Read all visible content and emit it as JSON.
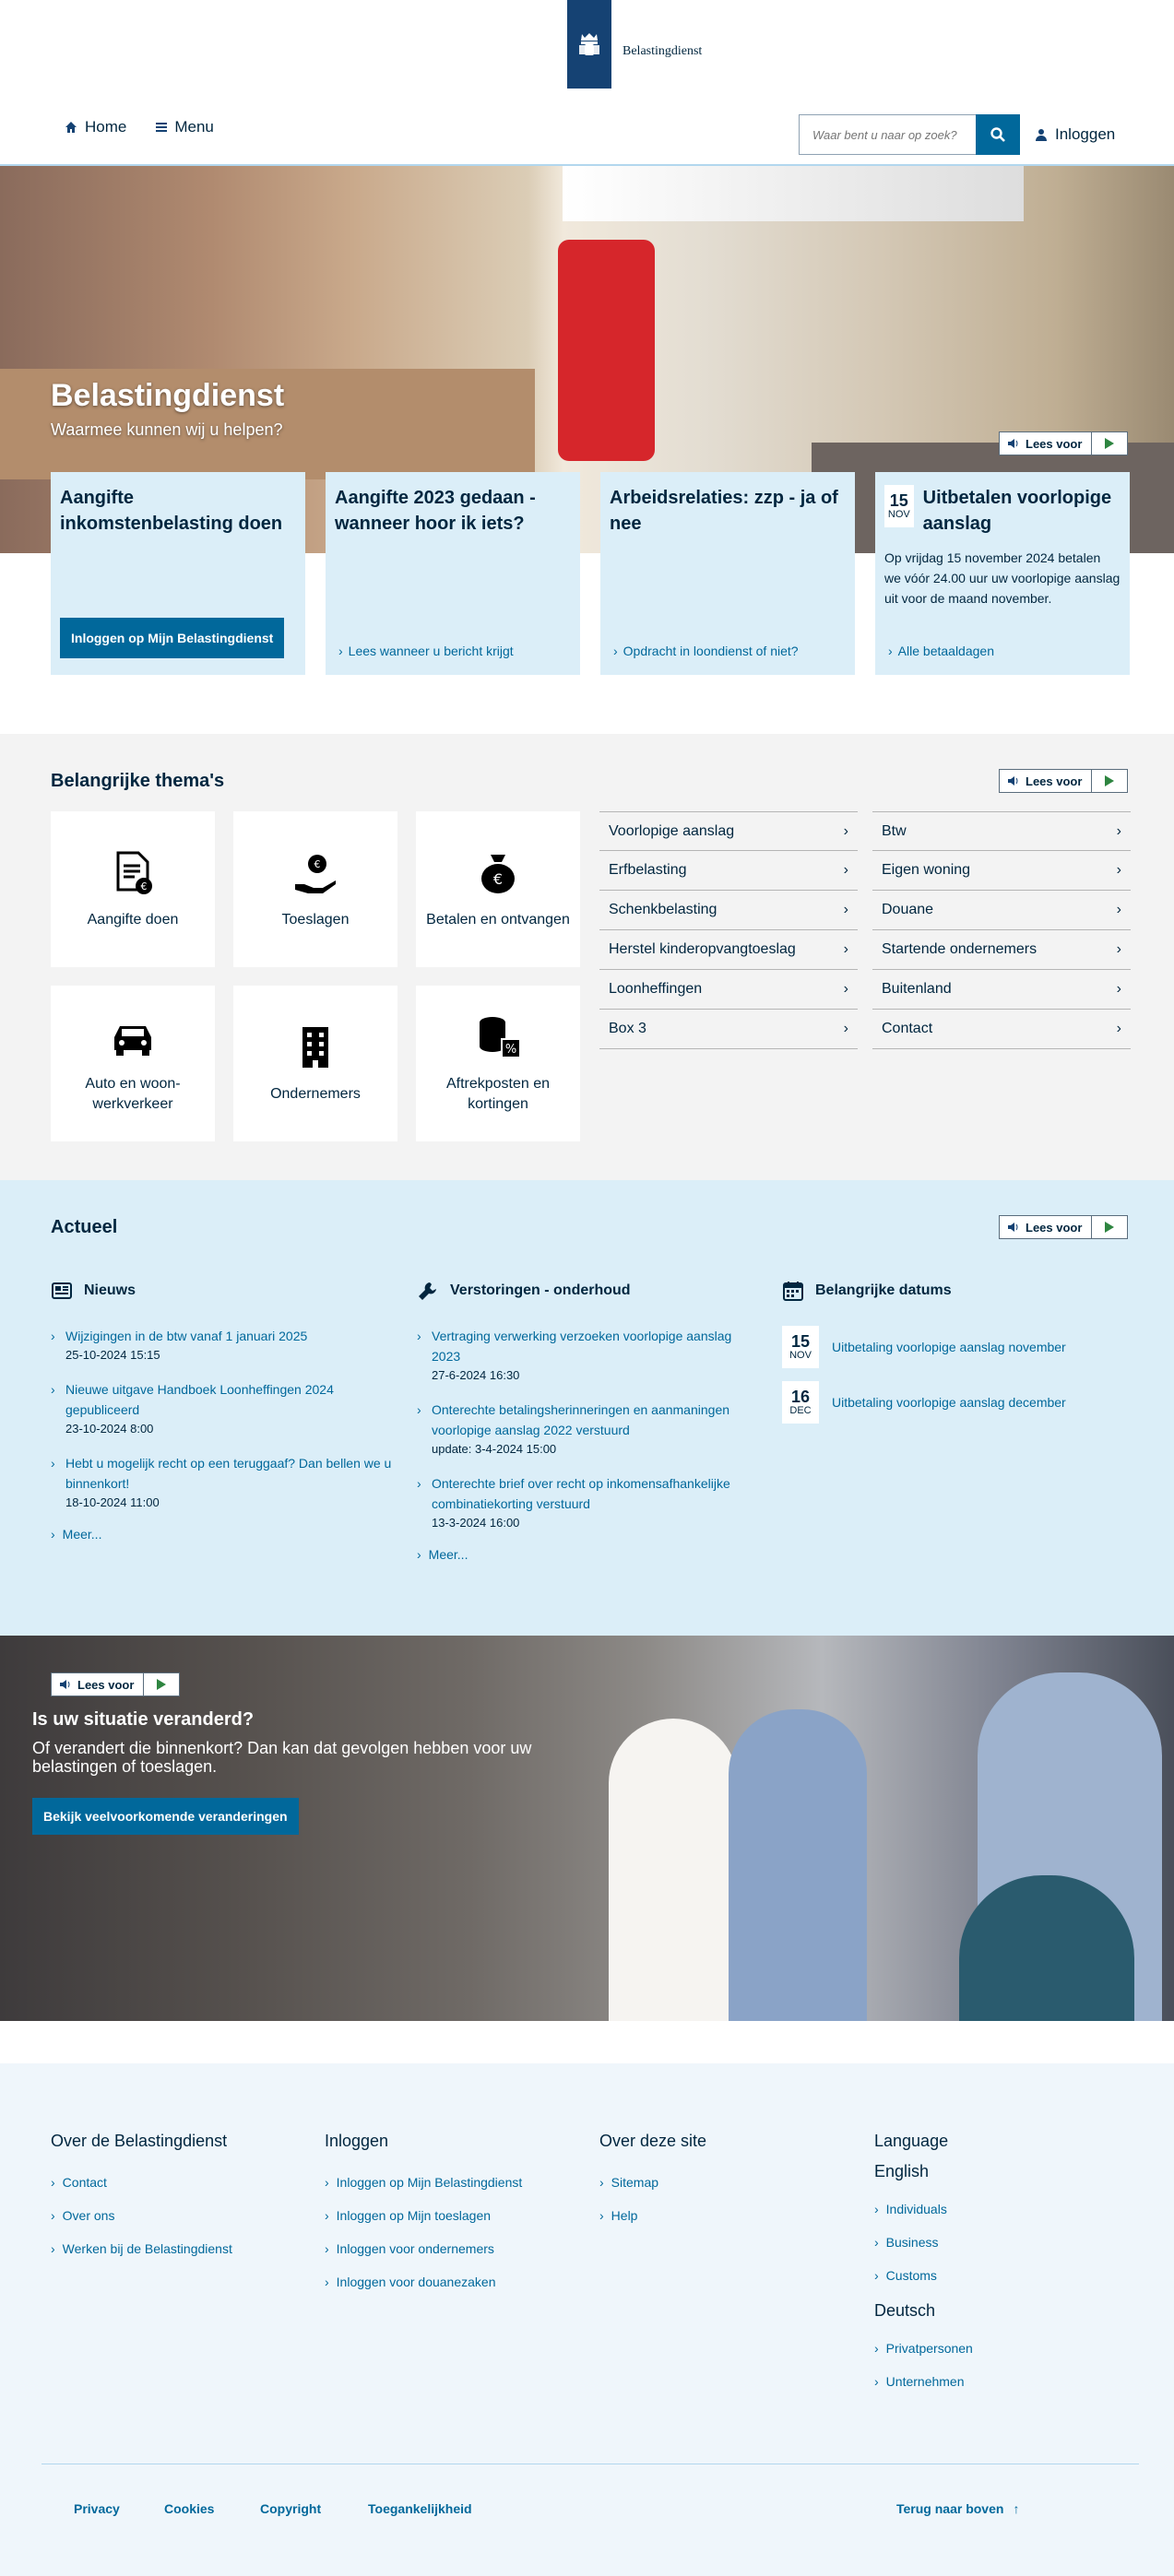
{
  "header": {
    "logo_text": "Belastingdienst",
    "nav_home": "Home",
    "nav_menu": "Menu",
    "search_placeholder": "Waar bent u naar op zoek?",
    "login": "Inloggen"
  },
  "hero": {
    "title": "Belastingdienst",
    "subtitle": "Waarmee kunnen wij u helpen?",
    "read_label": "Lees voor"
  },
  "cards": [
    {
      "title": "Aangifte inkomstenbelasting doen",
      "button": "Inloggen op Mijn Belastingdienst"
    },
    {
      "title": "Aangifte 2023 gedaan - wanneer hoor ik iets?",
      "link": "Lees wanneer u bericht krijgt"
    },
    {
      "title": "Arbeidsrelaties: zzp - ja of nee",
      "link": "Opdracht in loondienst of niet?"
    },
    {
      "day": "15",
      "month": "NOV",
      "title": "Uitbetalen voorlopige aanslag",
      "text": "Op vrijdag 15 november 2024 betalen we vóór 24.00 uur uw voorlopige aanslag uit voor de maand november.",
      "link": "Alle betaaldagen"
    }
  ],
  "themes": {
    "title": "Belangrijke thema's",
    "read_label": "Lees voor",
    "tiles": [
      "Aangifte doen",
      "Toeslagen",
      "Betalen en ontvangen",
      "Auto en woon-werkverkeer",
      "Ondernemers",
      "Aftrekposten en kortingen"
    ],
    "list_a": [
      "Voorlopige aanslag",
      "Erfbelasting",
      "Schenkbelasting",
      "Herstel kinderopvangtoeslag",
      "Loonheffingen",
      "Box 3"
    ],
    "list_b": [
      "Btw",
      "Eigen woning",
      "Douane",
      "Startende ondernemers",
      "Buitenland",
      "Contact"
    ]
  },
  "actueel": {
    "title": "Actueel",
    "read_label": "Lees voor",
    "news": {
      "heading": "Nieuws",
      "items": [
        {
          "text": "Wijzigingen in de btw vanaf 1 januari 2025",
          "date": "25-10-2024 15:15"
        },
        {
          "text": "Nieuwe uitgave Handboek Loonheffingen 2024 gepubliceerd",
          "date": "23-10-2024 8:00"
        },
        {
          "text": "Hebt u mogelijk recht op een teruggaaf? Dan bellen we u binnenkort!",
          "date": "18-10-2024 11:00"
        }
      ],
      "more": "Meer..."
    },
    "outages": {
      "heading": "Verstoringen - onderhoud",
      "items": [
        {
          "text": "Vertraging verwerking verzoeken voorlopige aanslag 2023",
          "date": "27-6-2024 16:30"
        },
        {
          "text": "Onterechte betalingsherinneringen en aanmaningen voorlopige aanslag 2022 verstuurd",
          "date": "update: 3-4-2024 15:00"
        },
        {
          "text": "Onterechte brief over recht op inkomensafhankelijke combinatiekorting verstuurd",
          "date": "13-3-2024 16:00"
        }
      ],
      "more": "Meer..."
    },
    "dates": {
      "heading": "Belangrijke datums",
      "items": [
        {
          "day": "15",
          "month": "NOV",
          "text": "Uitbetaling voorlopige aanslag november"
        },
        {
          "day": "16",
          "month": "DEC",
          "text": "Uitbetaling voorlopige aanslag december"
        }
      ]
    }
  },
  "banner": {
    "read_label": "Lees voor",
    "title": "Is uw situatie veranderd?",
    "text": "Of verandert die binnenkort? Dan kan dat gevolgen hebben voor uw belastingen of toeslagen.",
    "button": "Bekijk veelvoorkomende veranderingen"
  },
  "footer": {
    "col1": {
      "title": "Over de Belastingdienst",
      "links": [
        "Contact",
        "Over ons",
        "Werken bij de Belastingdienst"
      ]
    },
    "col2": {
      "title": "Inloggen",
      "links": [
        "Inloggen op Mijn Belastingdienst",
        "Inloggen op Mijn toeslagen",
        "Inloggen voor ondernemers",
        "Inloggen voor douanezaken"
      ]
    },
    "col3": {
      "title": "Over deze site",
      "links": [
        "Sitemap",
        "Help"
      ]
    },
    "col4": {
      "title": "Language",
      "english": "English",
      "english_links": [
        "Individuals",
        "Business",
        "Customs"
      ],
      "deutsch": "Deutsch",
      "deutsch_links": [
        "Privatpersonen",
        "Unternehmen"
      ]
    },
    "bottom": {
      "privacy": "Privacy",
      "cookies": "Cookies",
      "copyright": "Copyright",
      "accessibility": "Toegankelijkheid",
      "back_to_top": "Terug naar boven"
    }
  },
  "colors": {
    "brand": "#154273",
    "link": "#01689b",
    "light_blue": "#dbeef8",
    "grey_bg": "#f3f3f3"
  }
}
